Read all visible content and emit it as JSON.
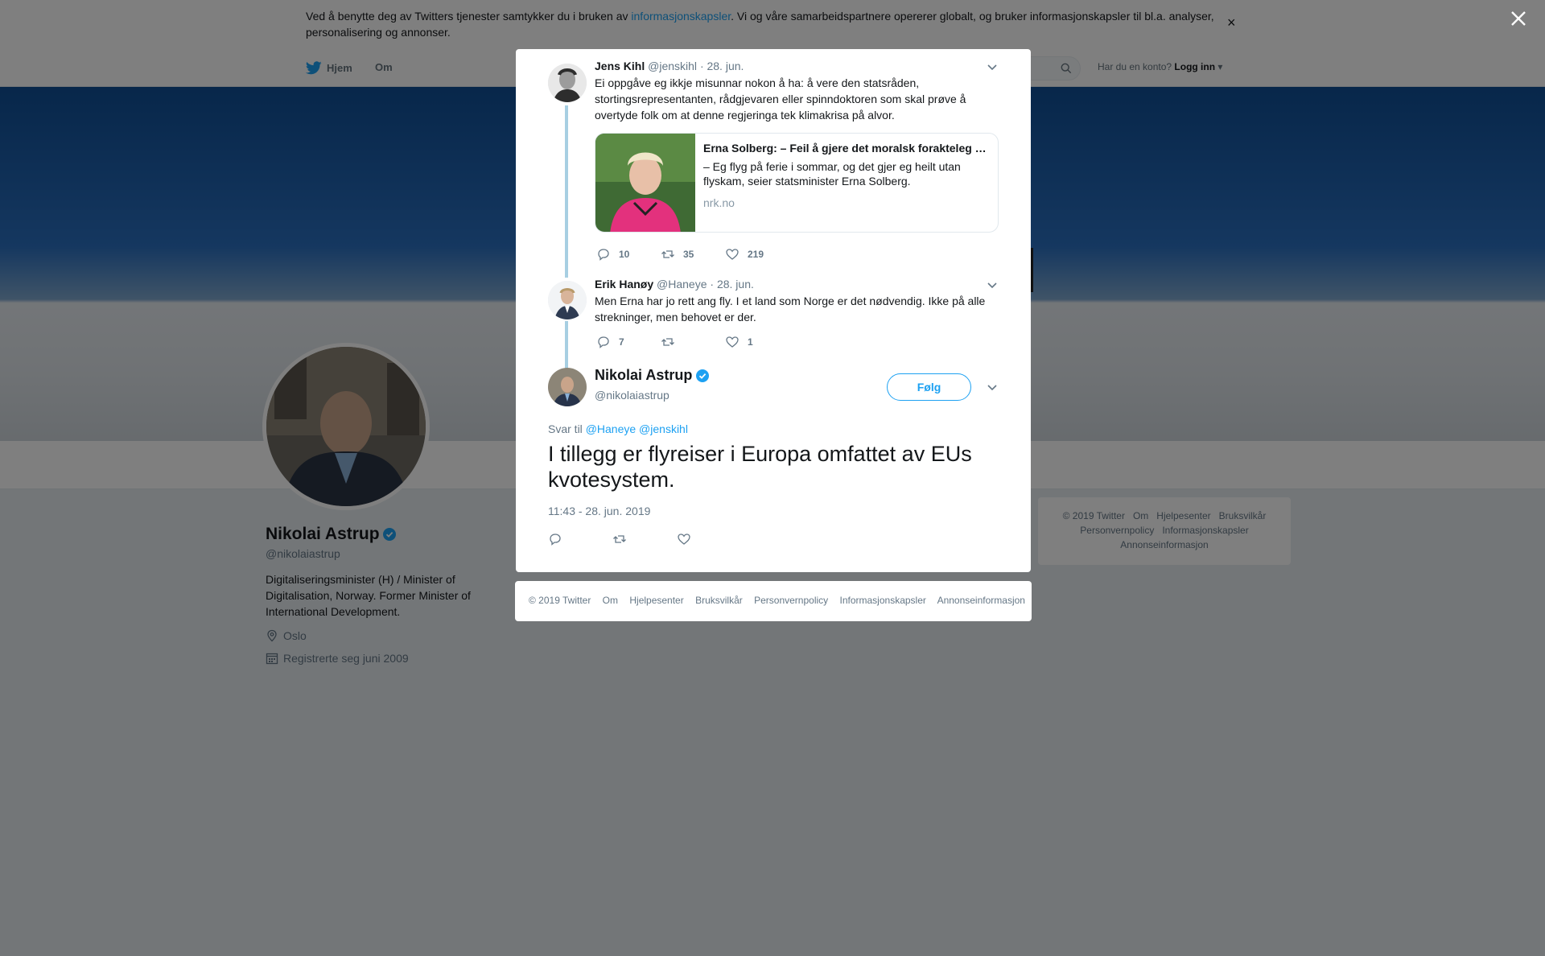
{
  "cookie": {
    "text_before": "Ved å benytte deg av Twitters tjenester samtykker du i bruken av ",
    "link": "informasjonskapsler",
    "text_after": ". Vi og våre samarbeidspartnere opererer globalt, og bruker informasjonskapsler til bl.a. analyser, personalisering og annonser.",
    "close": "×"
  },
  "nav": {
    "home": "Hjem",
    "about": "Om",
    "login_prompt": "Har du en konto?",
    "login": "Logg inn"
  },
  "profile": {
    "name": "Nikolai Astrup",
    "handle": "@nikolaiastrup",
    "bio": "Digitaliseringsminister (H) / Minister of Digitalisation, Norway. Former Minister of International Development.",
    "location": "Oslo",
    "joined": "Registrerte seg juni 2009"
  },
  "side_footer": [
    "© 2019 Twitter",
    "Om",
    "Hjelpesenter",
    "Bruksvilkår",
    "Personvernpolicy",
    "Informasjonskapsler",
    "Annonseinformasjon"
  ],
  "thread": [
    {
      "name": "Jens Kihl",
      "handle": "@jenskihl",
      "date": "· 28. jun.",
      "text": "Ei oppgåve eg ikkje misunnar nokon å ha: å vere den statsråden, stortingsrepresentanten, rådgjevaren eller spinndoktoren som skal prøve å overtyde folk om at denne regjeringa tek klimakrisa på alvor.",
      "card": {
        "title": "Erna Solberg: – Feil å gjere det moralsk forakteleg å fly",
        "desc": "– Eg flyg på ferie i sommar, og det gjer eg heilt utan flyskam, seier statsminister Erna Solberg.",
        "domain": "nrk.no"
      },
      "replies": "10",
      "retweets": "35",
      "likes": "219"
    },
    {
      "name": "Erik Hanøy",
      "handle": "@Haneye",
      "date": "· 28. jun.",
      "text": "Men Erna har jo rett ang fly. I et land som Norge er det nødvendig. Ikke på alle strekninger, men behovet er der.",
      "replies": "7",
      "retweets": "",
      "likes": "1"
    }
  ],
  "main_tweet": {
    "name": "Nikolai Astrup",
    "handle": "@nikolaiastrup",
    "follow": "Følg",
    "reply_label": "Svar til",
    "reply_to": "@Haneye @jenskihl",
    "text": "I tillegg er flyreiser i Europa omfattet av EUs kvotesystem.",
    "time": "11:43 - 28. jun. 2019"
  },
  "modal_footer": [
    "© 2019 Twitter",
    "Om",
    "Hjelpesenter",
    "Bruksvilkår",
    "Personvernpolicy",
    "Informasjonskapsler",
    "Annonseinformasjon"
  ],
  "colors": {
    "accent": "#1da1f2",
    "thread_line": "#a7cfe2",
    "overlay": "rgba(0,0,0,0.5)"
  },
  "icons": [
    "twitter-bird-icon",
    "search-icon",
    "close-icon",
    "verified-icon",
    "location-icon",
    "calendar-icon",
    "reply-icon",
    "retweet-icon",
    "like-icon",
    "chevron-down-icon"
  ]
}
